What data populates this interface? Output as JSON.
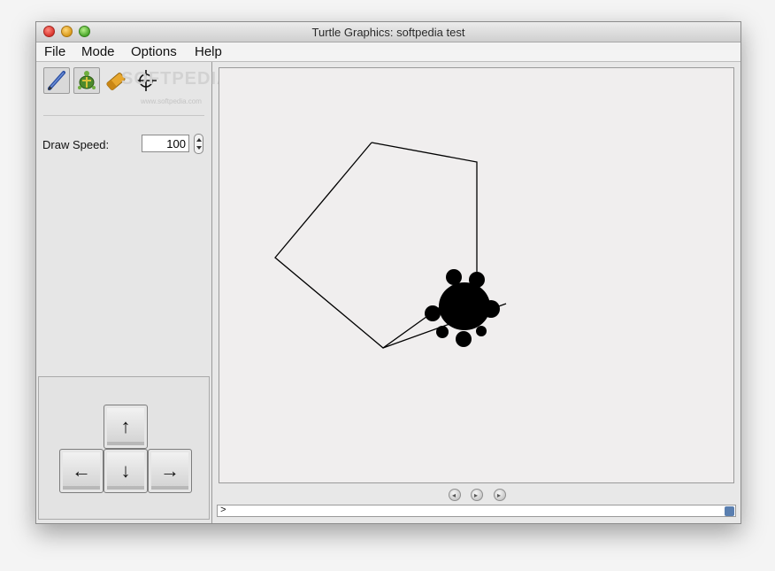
{
  "window": {
    "title": "Turtle Graphics: softpedia test"
  },
  "menu": [
    "File",
    "Mode",
    "Options",
    "Help"
  ],
  "toolbar": {
    "tools": [
      "pencil-icon",
      "turtle-icon",
      "eraser-icon",
      "crosshair-icon"
    ],
    "watermark": "SOFTPEDIA",
    "watermark_url": "www.softpedia.com"
  },
  "draw_speed": {
    "label": "Draw Speed:",
    "value": "100"
  },
  "arrow_keys": {
    "up": "↑",
    "left": "←",
    "down": "↓",
    "right": "→"
  },
  "command_line": {
    "prompt": ">"
  },
  "colors": {
    "stroke": "#000000",
    "canvas": "#f0eeee"
  }
}
